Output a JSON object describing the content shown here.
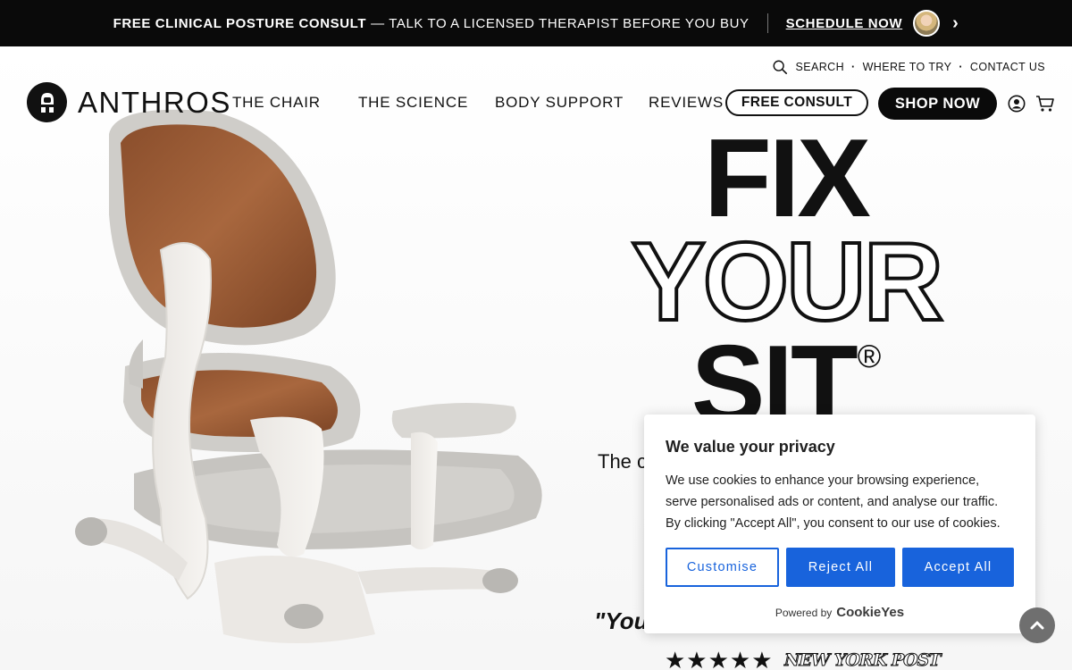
{
  "announcement": {
    "bold_text": "FREE CLINICAL POSTURE CONSULT",
    "rest_text": "— TALK TO A LICENSED THERAPIST BEFORE YOU BUY",
    "cta": "SCHEDULE NOW",
    "chevron": "›"
  },
  "utility_nav": {
    "search": "SEARCH",
    "where_to_try": "WHERE TO TRY",
    "contact": "CONTACT US",
    "separator": "·"
  },
  "logo": {
    "wordmark": "ANTHROS"
  },
  "main_nav": {
    "items": [
      "THE CHAIR",
      "THE SCIENCE",
      "BODY SUPPORT",
      "REVIEWS"
    ],
    "free_consult": "FREE CONSULT",
    "shop_now": "SHOP NOW"
  },
  "hero": {
    "line1": "FIX",
    "line2": "YOUR",
    "line3": "SIT",
    "registered": "®",
    "subhead_visible": "The c",
    "quote_visible": "\"You",
    "stars": "★★★★★",
    "press_logo": "NEW YORK POST"
  },
  "cookie_banner": {
    "title": "We value your privacy",
    "description": "We use cookies to enhance your browsing experience, serve personalised ads or content, and analyse our traffic. By clicking \"Accept All\", you consent to our use of cookies.",
    "customise": "Customise",
    "reject_all": "Reject All",
    "accept_all": "Accept All",
    "powered_by": "Powered by",
    "brand": "CookieYes"
  },
  "icons": {
    "search": "search-icon",
    "account": "user-icon",
    "cart": "cart-icon",
    "scroll_top": "chevron-up-icon",
    "avatar": "therapist-avatar"
  },
  "colors": {
    "announcement_bg": "#0a0a0a",
    "cookie_blue": "#1863dc",
    "text": "#111111"
  }
}
